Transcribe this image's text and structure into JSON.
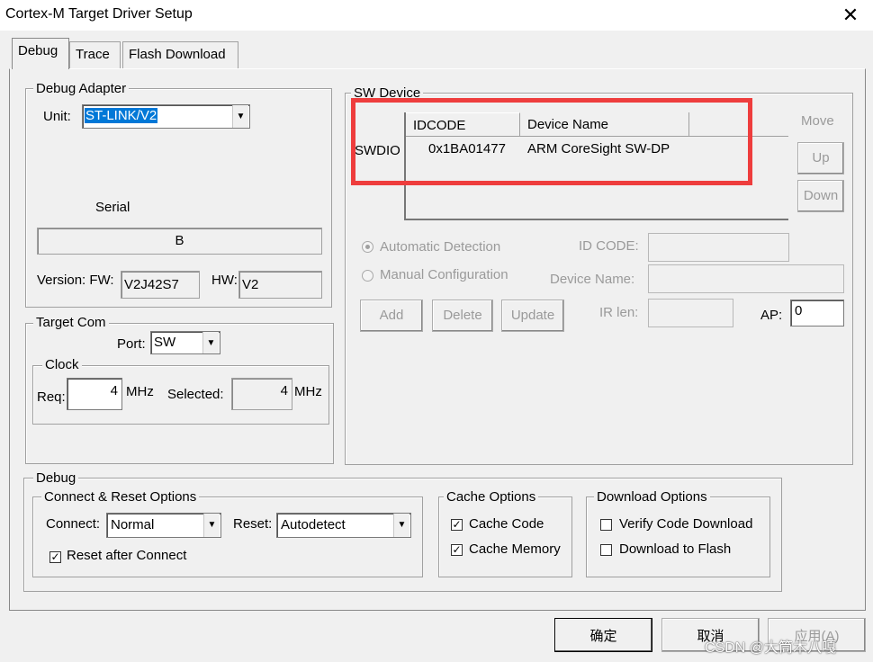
{
  "window": {
    "title": "Cortex-M Target Driver Setup",
    "close_glyph": "✕"
  },
  "tabs": [
    {
      "label": "Debug"
    },
    {
      "label": "Trace"
    },
    {
      "label": "Flash Download"
    }
  ],
  "debug_adapter": {
    "legend": "Debug Adapter",
    "unit_label": "Unit:",
    "unit_value": "ST-LINK/V2",
    "serial_label": "Serial",
    "serial_value": "B",
    "version_label": "Version: FW:",
    "fw_value": "V2J42S7",
    "hw_label": "HW:",
    "hw_value": "V2"
  },
  "target_com": {
    "legend": "Target Com",
    "port_label": "Port:",
    "port_value": "SW",
    "clock_legend": "Clock",
    "req_label": "Req:",
    "req_value": "4",
    "req_unit": "MHz",
    "selected_label": "Selected:",
    "selected_value": "4",
    "selected_unit": "MHz"
  },
  "sw_device": {
    "legend": "SW Device",
    "columns": [
      "IDCODE",
      "Device Name"
    ],
    "row_label": "SWDIO",
    "rows": [
      {
        "idcode": "0x1BA01477",
        "device_name": "ARM CoreSight SW-DP"
      }
    ],
    "move_label": "Move",
    "up_label": "Up",
    "down_label": "Down",
    "auto_detect_label": "Automatic Detection",
    "manual_config_label": "Manual Configuration",
    "id_code_label": "ID CODE:",
    "device_name_label": "Device Name:",
    "ir_len_label": "IR len:",
    "ap_label": "AP:",
    "ap_value": "0",
    "add_label": "Add",
    "delete_label": "Delete",
    "update_label": "Update",
    "highlight_color": "#ee3d3d"
  },
  "debug": {
    "legend": "Debug",
    "connect_reset_legend": "Connect & Reset Options",
    "connect_label": "Connect:",
    "connect_value": "Normal",
    "reset_label": "Reset:",
    "reset_value": "Autodetect",
    "reset_after_connect_label": "Reset after Connect",
    "reset_after_connect_checked": true,
    "cache_legend": "Cache Options",
    "cache_code_label": "Cache Code",
    "cache_code_checked": true,
    "cache_memory_label": "Cache Memory",
    "cache_memory_checked": true,
    "download_legend": "Download Options",
    "verify_label": "Verify Code Download",
    "verify_checked": false,
    "download_flash_label": "Download to Flash",
    "download_flash_checked": false
  },
  "footer": {
    "ok_label": "确定",
    "cancel_label": "取消",
    "apply_label": "应用(A)",
    "watermark": "CSDN @大筒木八嘎"
  }
}
